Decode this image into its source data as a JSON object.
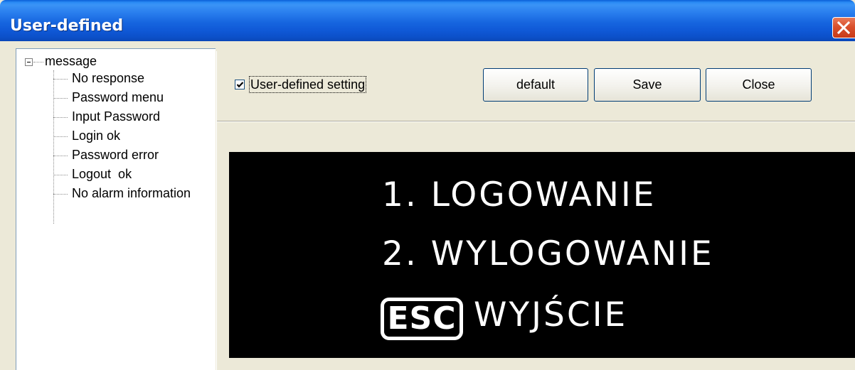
{
  "window": {
    "title": "User-defined"
  },
  "tree": {
    "root": "message",
    "items": [
      "No response",
      "Password menu",
      "Input Password",
      "Login ok",
      "Password error",
      "Logout  ok",
      "No alarm information"
    ]
  },
  "toolbar": {
    "checkbox_label": "User-defined setting",
    "checkbox_checked": true,
    "default_label": "default",
    "save_label": "Save",
    "close_label": "Close"
  },
  "display": {
    "line1": "1. LOGOWANIE",
    "line2": "2. WYLOGOWANIE",
    "esc_key": "ESC",
    "line3": "WYJŚCIE"
  },
  "icons": {
    "close": "close-icon",
    "expander": "tree-collapse-icon",
    "check": "checkmark-icon"
  },
  "colors": {
    "titlebar": "#0f58d6",
    "close_button": "#d9502c",
    "display_background": "#000000",
    "display_text": "#ffffff"
  }
}
